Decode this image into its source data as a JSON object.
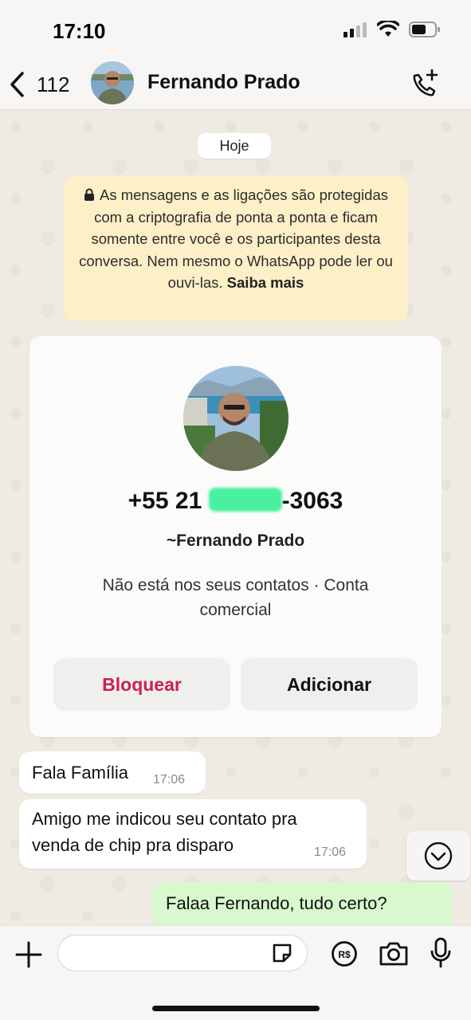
{
  "status_bar": {
    "time": "17:10"
  },
  "header": {
    "back_count": "112",
    "contact_name": "Fernando Prado",
    "icons": {
      "back": "chevron-left-icon",
      "call": "phone-add-icon"
    }
  },
  "chat": {
    "date_label": "Hoje",
    "encryption_notice": {
      "text": "As mensagens e as ligações são protegidas com a criptografia de ponta a ponta e ficam somente entre você e os participantes desta conversa. Nem mesmo o WhatsApp pode ler ou ouvi-las.",
      "link": "Saiba mais"
    },
    "contact_card": {
      "phone_prefix": "+55 21",
      "phone_suffix": "-3063",
      "display_name": "~Fernando Prado",
      "info": "Não está nos seus contatos · Conta comercial",
      "block_label": "Bloquear",
      "add_label": "Adicionar"
    },
    "messages": [
      {
        "direction": "in",
        "text": "Fala Família",
        "time": "17:06"
      },
      {
        "direction": "in",
        "text_line1": "Amigo me indicou seu contato pra",
        "text_line2": "venda de chip pra disparo",
        "time": "17:06"
      },
      {
        "direction": "out",
        "text": "Falaa Fernando, tudo certo?"
      }
    ]
  },
  "input_bar": {
    "placeholder": "",
    "icons": [
      "plus-icon",
      "sticker-icon",
      "payment-icon",
      "camera-icon",
      "microphone-icon"
    ]
  },
  "colors": {
    "chat_background": "#efeae2",
    "incoming_bubble": "#ffffff",
    "outgoing_bubble": "#d7f9cd",
    "notice_background": "#fdefc7",
    "block_red": "#c8234f"
  }
}
